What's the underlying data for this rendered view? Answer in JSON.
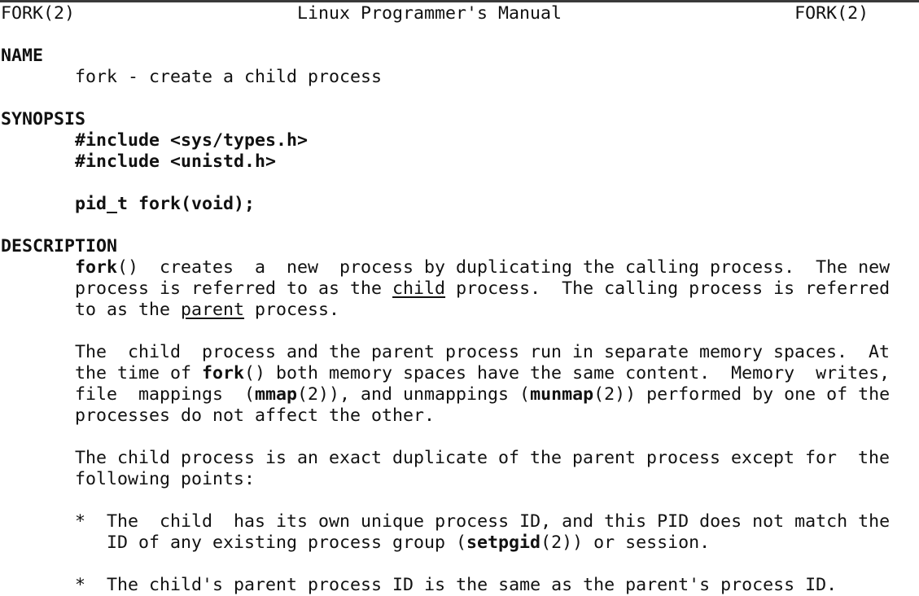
{
  "header": {
    "left": "FORK(2)",
    "center": "Linux Programmer's Manual",
    "right": "FORK(2)"
  },
  "sections": {
    "name": {
      "heading": "NAME",
      "text": "fork - create a child process"
    },
    "synopsis": {
      "heading": "SYNOPSIS",
      "include1": "#include <sys/types.h>",
      "include2": "#include <unistd.h>",
      "prototype": "pid_t fork(void);"
    },
    "description": {
      "heading": "DESCRIPTION",
      "p1": [
        "fork",
        "()  creates  a  new  process by duplicating the calling process.  The new",
        "process is referred to as the ",
        "child",
        " process.  The calling process is referred",
        "to as the ",
        "parent",
        " process."
      ],
      "p2": [
        "The  child  process and the parent process run in separate memory spaces.  At",
        "the time of ",
        "fork",
        "() both memory spaces have the same content.  Memory  writes,",
        "file  mappings  (",
        "mmap",
        "(2)), and unmappings (",
        "munmap",
        "(2)) performed by one of the",
        "processes do not affect the other."
      ],
      "p3": [
        "The child process is an exact duplicate of the parent process except for  the",
        "following points:"
      ],
      "bullet_marker": "*",
      "bullet1": [
        "The  child  has its own unique process ID, and this PID does not match the",
        "ID of any existing process group (",
        "setpgid",
        "(2)) or session."
      ],
      "bullet2": [
        "The child's parent process ID is the same as the parent's process ID."
      ]
    }
  }
}
